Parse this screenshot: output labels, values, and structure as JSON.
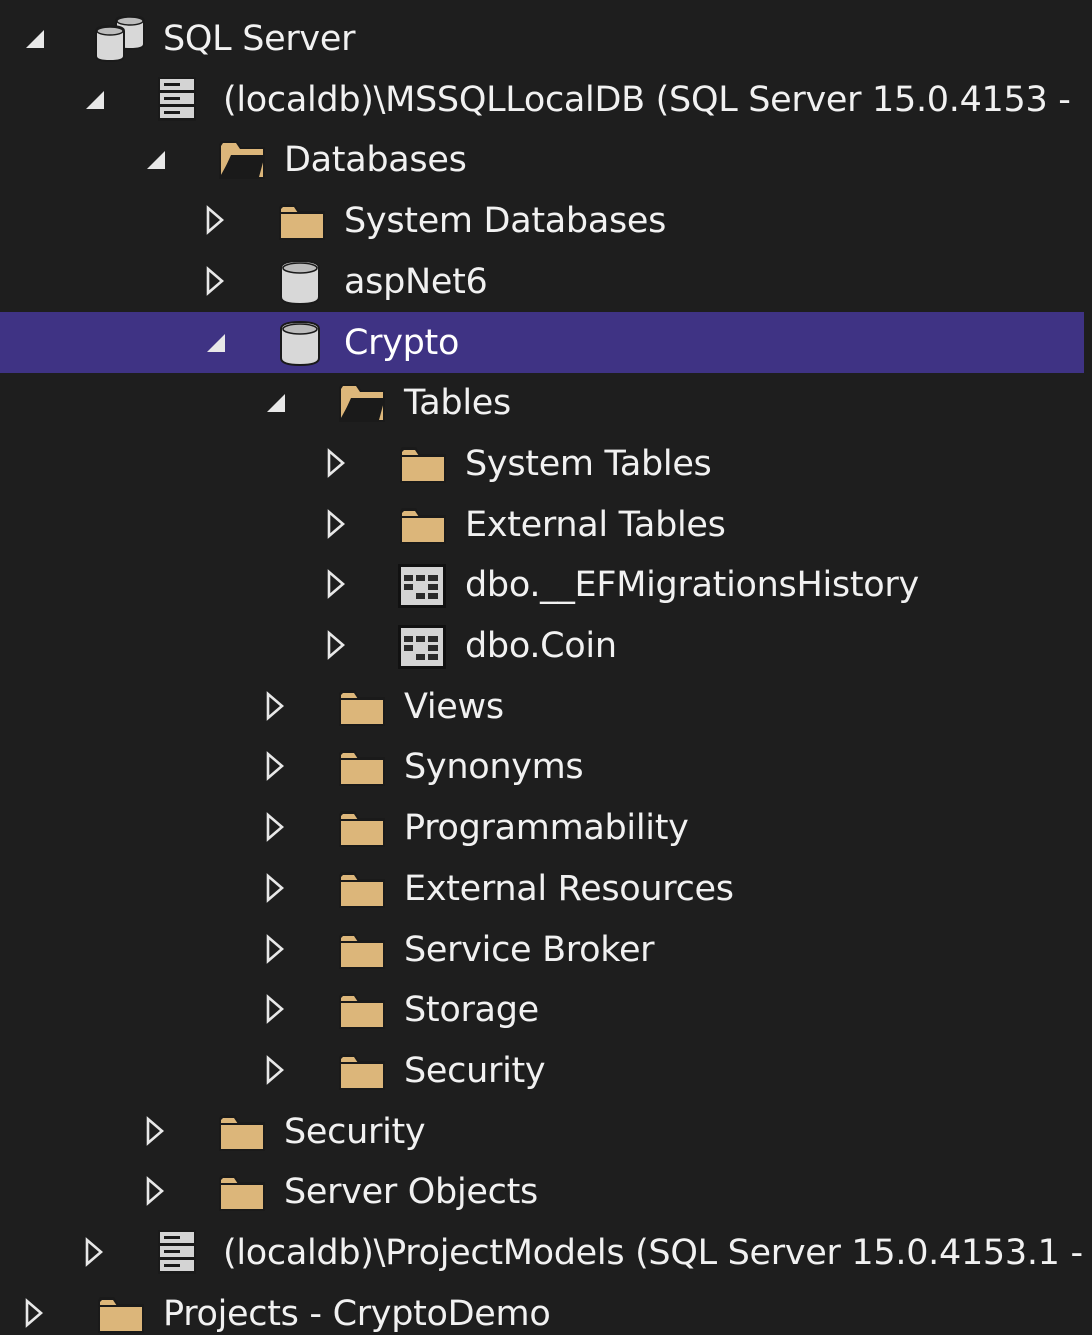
{
  "panel": "SQL Server Object Explorer",
  "colors": {
    "background": "#1e1e1e",
    "selection": "#3f3384",
    "folder": "#dcb67a",
    "text": "#f1f1f1"
  },
  "rows": [
    {
      "label": "SQL Server",
      "state": "expanded",
      "icon": "sql-server-icon",
      "level": 0
    },
    {
      "label": "(localdb)\\MSSQLLocalDB (SQL Server 15.0.4153 -",
      "state": "expanded",
      "icon": "server-icon",
      "level": 1
    },
    {
      "label": "Databases",
      "state": "expanded",
      "icon": "folder-open-icon",
      "level": 2
    },
    {
      "label": "System Databases",
      "state": "collapsed",
      "icon": "folder-icon",
      "level": 3
    },
    {
      "label": "aspNet6",
      "state": "collapsed",
      "icon": "database-icon",
      "level": 3
    },
    {
      "label": "Crypto",
      "state": "expanded",
      "icon": "database-icon",
      "level": 3,
      "selected": true
    },
    {
      "label": "Tables",
      "state": "expanded",
      "icon": "folder-open-icon",
      "level": 4
    },
    {
      "label": "System Tables",
      "state": "collapsed",
      "icon": "folder-icon",
      "level": 5
    },
    {
      "label": "External Tables",
      "state": "collapsed",
      "icon": "folder-icon",
      "level": 5
    },
    {
      "label": "dbo.__EFMigrationsHistory",
      "state": "collapsed",
      "icon": "table-icon",
      "level": 5
    },
    {
      "label": "dbo.Coin",
      "state": "collapsed",
      "icon": "table-icon",
      "level": 5
    },
    {
      "label": "Views",
      "state": "collapsed",
      "icon": "folder-icon",
      "level": 4
    },
    {
      "label": "Synonyms",
      "state": "collapsed",
      "icon": "folder-icon",
      "level": 4
    },
    {
      "label": "Programmability",
      "state": "collapsed",
      "icon": "folder-icon",
      "level": 4
    },
    {
      "label": "External Resources",
      "state": "collapsed",
      "icon": "folder-icon",
      "level": 4
    },
    {
      "label": "Service Broker",
      "state": "collapsed",
      "icon": "folder-icon",
      "level": 4
    },
    {
      "label": "Storage",
      "state": "collapsed",
      "icon": "folder-icon",
      "level": 4
    },
    {
      "label": "Security",
      "state": "collapsed",
      "icon": "folder-icon",
      "level": 4
    },
    {
      "label": "Security",
      "state": "collapsed",
      "icon": "folder-icon",
      "level": 2
    },
    {
      "label": "Server Objects",
      "state": "collapsed",
      "icon": "folder-icon",
      "level": 2
    },
    {
      "label": "(localdb)\\ProjectModels (SQL Server 15.0.4153.1 -",
      "state": "collapsed",
      "icon": "server-icon",
      "level": 1
    },
    {
      "label": "Projects - CryptoDemo",
      "state": "collapsed",
      "icon": "folder-icon",
      "level": 0
    }
  ]
}
